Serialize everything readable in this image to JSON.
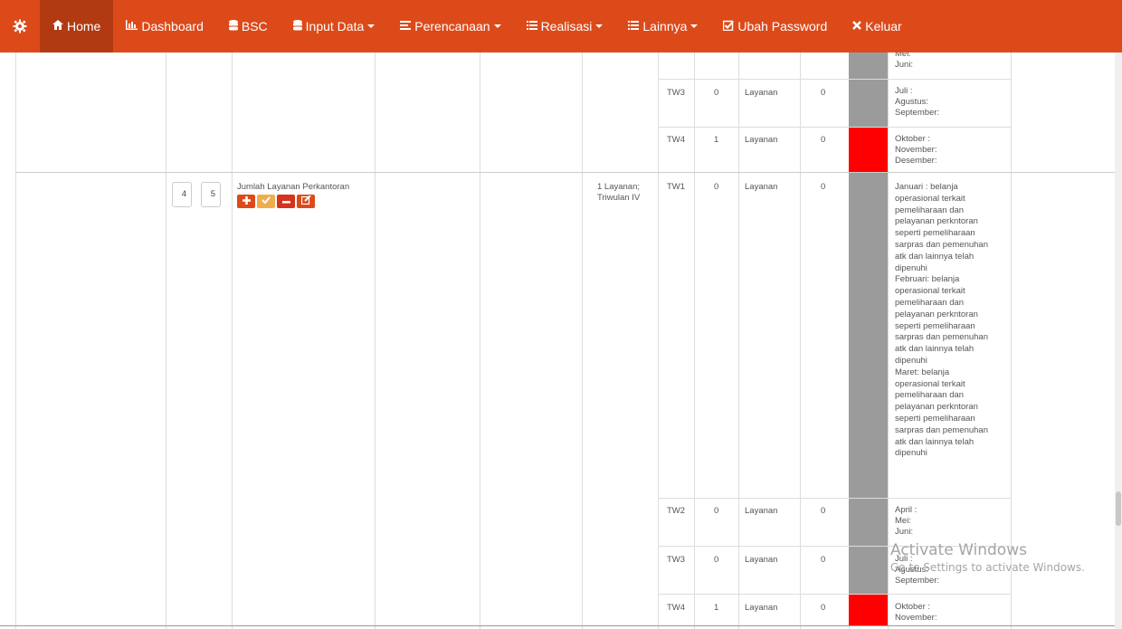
{
  "nav": {
    "items": [
      {
        "label": "Home",
        "icon": "home-icon"
      },
      {
        "label": "Dashboard",
        "icon": "bar-chart-icon"
      },
      {
        "label": "BSC",
        "icon": "database-icon"
      },
      {
        "label": "Input Data",
        "icon": "database-icon"
      },
      {
        "label": "Perencanaan",
        "icon": "list-icon"
      },
      {
        "label": "Realisasi",
        "icon": "list-icon"
      },
      {
        "label": "Lainnya",
        "icon": "list-icon"
      },
      {
        "label": "Ubah Password",
        "icon": "check-square-icon"
      },
      {
        "label": "Keluar",
        "icon": "close-icon"
      }
    ],
    "color": "#dc4a1a",
    "active_color": "#b23a12"
  },
  "table": {
    "top_months": "Mei:\nJuni:",
    "rows_a": [
      {
        "tw": "TW3",
        "val": "0",
        "unit": "Layanan",
        "real": "0",
        "months": "Juli :\nAgustus:\nSeptember:"
      },
      {
        "tw": "TW4",
        "val": "1",
        "unit": "Layanan",
        "real": "0",
        "months": "Oktober :\nNovember:\nDesember:"
      }
    ],
    "item": {
      "num1": "4",
      "num2": "5",
      "indicator": "Jumlah Layanan Perkantoran",
      "target": "1 Layanan;\nTriwulan IV"
    },
    "rows_b": [
      {
        "tw": "TW1",
        "val": "0",
        "unit": "Layanan",
        "real": "0",
        "months": "Januari : belanja\noperasional terkait\npemeliharaan dan\npelayanan perkntoran\nseperti pemeliharaan\nsarpras dan pemenuhan\natk dan lainnya telah\ndipenuhi\nFebruari: belanja\noperasional terkait\npemeliharaan dan\npelayanan perkntoran\nseperti pemeliharaan\nsarpras dan pemenuhan\natk dan lainnya telah\ndipenuhi\nMaret: belanja\noperasional terkait\npemeliharaan dan\npelayanan perkntoran\nseperti pemeliharaan\nsarpras dan pemenuhan\natk dan lainnya telah\ndipenuhi"
      },
      {
        "tw": "TW2",
        "val": "0",
        "unit": "Layanan",
        "real": "0",
        "months": "April :\nMei:\nJuni:"
      },
      {
        "tw": "TW3",
        "val": "0",
        "unit": "Layanan",
        "real": "0",
        "months": "Juli :\nAgustus:\nSeptember:"
      },
      {
        "tw": "TW4",
        "val": "1",
        "unit": "Layanan",
        "real": "0",
        "months": "Oktober :\nNovember:"
      }
    ],
    "status_colors": {
      "gray": "#9b9b9b",
      "red": "#ff0000"
    }
  },
  "watermark": {
    "line1": "Activate Windows",
    "line2": "Go to Settings to activate Windows."
  }
}
